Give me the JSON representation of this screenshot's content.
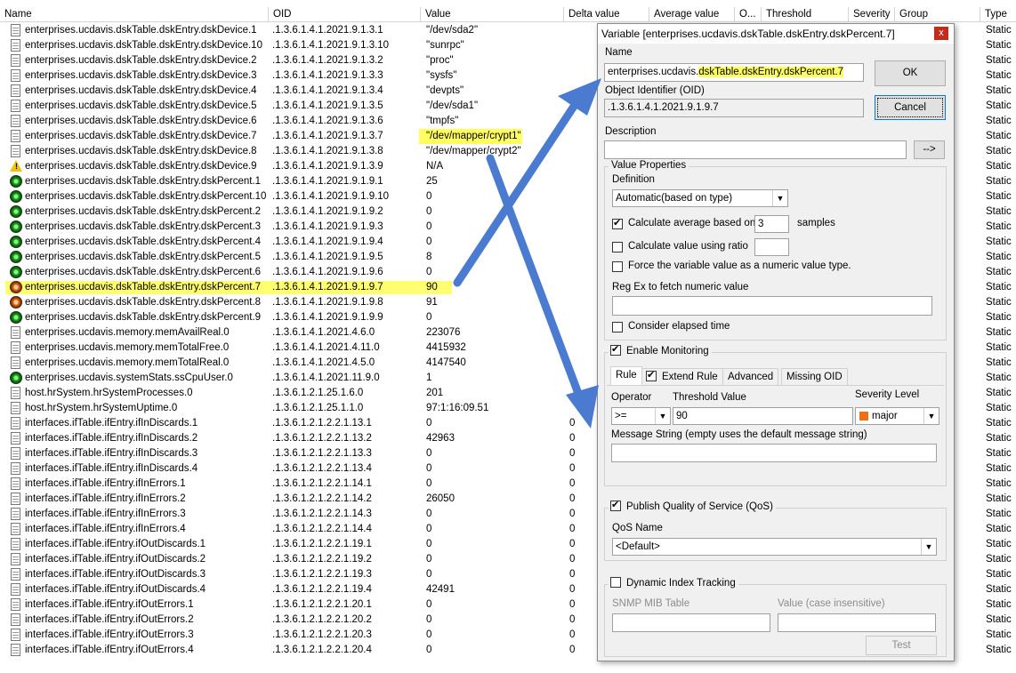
{
  "columns": {
    "name": "Name",
    "oid": "OID",
    "value": "Value",
    "delta": "Delta value",
    "average": "Average value",
    "o": "O...",
    "threshold": "Threshold",
    "severity": "Severity",
    "group": "Group",
    "type": "Type"
  },
  "rows": [
    {
      "icon": "doc",
      "name": "enterprises.ucdavis.dskTable.dskEntry.dskDevice.1",
      "oid": ".1.3.6.1.4.1.2021.9.1.3.1",
      "value": "\"/dev/sda2\"",
      "delta": "",
      "type": "Static"
    },
    {
      "icon": "doc",
      "name": "enterprises.ucdavis.dskTable.dskEntry.dskDevice.10",
      "oid": ".1.3.6.1.4.1.2021.9.1.3.10",
      "value": "\"sunrpc\"",
      "delta": "",
      "type": "Static"
    },
    {
      "icon": "doc",
      "name": "enterprises.ucdavis.dskTable.dskEntry.dskDevice.2",
      "oid": ".1.3.6.1.4.1.2021.9.1.3.2",
      "value": "\"proc\"",
      "delta": "",
      "type": "Static"
    },
    {
      "icon": "doc",
      "name": "enterprises.ucdavis.dskTable.dskEntry.dskDevice.3",
      "oid": ".1.3.6.1.4.1.2021.9.1.3.3",
      "value": "\"sysfs\"",
      "delta": "",
      "type": "Static"
    },
    {
      "icon": "doc",
      "name": "enterprises.ucdavis.dskTable.dskEntry.dskDevice.4",
      "oid": ".1.3.6.1.4.1.2021.9.1.3.4",
      "value": "\"devpts\"",
      "delta": "",
      "type": "Static"
    },
    {
      "icon": "doc",
      "name": "enterprises.ucdavis.dskTable.dskEntry.dskDevice.5",
      "oid": ".1.3.6.1.4.1.2021.9.1.3.5",
      "value": "\"/dev/sda1\"",
      "delta": "",
      "type": "Static"
    },
    {
      "icon": "doc",
      "name": "enterprises.ucdavis.dskTable.dskEntry.dskDevice.6",
      "oid": ".1.3.6.1.4.1.2021.9.1.3.6",
      "value": "\"tmpfs\"",
      "delta": "",
      "type": "Static"
    },
    {
      "icon": "doc",
      "name": "enterprises.ucdavis.dskTable.dskEntry.dskDevice.7",
      "oid": ".1.3.6.1.4.1.2021.9.1.3.7",
      "value": "\"/dev/mapper/crypt1\"",
      "delta": "",
      "type": "Static",
      "hl_value": true
    },
    {
      "icon": "doc",
      "name": "enterprises.ucdavis.dskTable.dskEntry.dskDevice.8",
      "oid": ".1.3.6.1.4.1.2021.9.1.3.8",
      "value": "\"/dev/mapper/crypt2\"",
      "delta": "",
      "type": "Static"
    },
    {
      "icon": "warn",
      "name": "enterprises.ucdavis.dskTable.dskEntry.dskDevice.9",
      "oid": ".1.3.6.1.4.1.2021.9.1.3.9",
      "value": "N/A",
      "delta": "",
      "type": "Static"
    },
    {
      "icon": "ok",
      "name": "enterprises.ucdavis.dskTable.dskEntry.dskPercent.1",
      "oid": ".1.3.6.1.4.1.2021.9.1.9.1",
      "value": "25",
      "delta": "",
      "type": "Static"
    },
    {
      "icon": "ok",
      "name": "enterprises.ucdavis.dskTable.dskEntry.dskPercent.10",
      "oid": ".1.3.6.1.4.1.2021.9.1.9.10",
      "value": "0",
      "delta": "",
      "type": "Static"
    },
    {
      "icon": "ok",
      "name": "enterprises.ucdavis.dskTable.dskEntry.dskPercent.2",
      "oid": ".1.3.6.1.4.1.2021.9.1.9.2",
      "value": "0",
      "delta": "",
      "type": "Static"
    },
    {
      "icon": "ok",
      "name": "enterprises.ucdavis.dskTable.dskEntry.dskPercent.3",
      "oid": ".1.3.6.1.4.1.2021.9.1.9.3",
      "value": "0",
      "delta": "",
      "type": "Static"
    },
    {
      "icon": "ok",
      "name": "enterprises.ucdavis.dskTable.dskEntry.dskPercent.4",
      "oid": ".1.3.6.1.4.1.2021.9.1.9.4",
      "value": "0",
      "delta": "",
      "type": "Static"
    },
    {
      "icon": "ok",
      "name": "enterprises.ucdavis.dskTable.dskEntry.dskPercent.5",
      "oid": ".1.3.6.1.4.1.2021.9.1.9.5",
      "value": "8",
      "delta": "",
      "type": "Static"
    },
    {
      "icon": "ok",
      "name": "enterprises.ucdavis.dskTable.dskEntry.dskPercent.6",
      "oid": ".1.3.6.1.4.1.2021.9.1.9.6",
      "value": "0",
      "delta": "",
      "type": "Static"
    },
    {
      "icon": "major",
      "name": "enterprises.ucdavis.dskTable.dskEntry.dskPercent.7",
      "oid": ".1.3.6.1.4.1.2021.9.1.9.7",
      "value": "90",
      "delta": "",
      "type": "Static",
      "hl_row": true
    },
    {
      "icon": "major",
      "name": "enterprises.ucdavis.dskTable.dskEntry.dskPercent.8",
      "oid": ".1.3.6.1.4.1.2021.9.1.9.8",
      "value": "91",
      "delta": "",
      "type": "Static"
    },
    {
      "icon": "ok",
      "name": "enterprises.ucdavis.dskTable.dskEntry.dskPercent.9",
      "oid": ".1.3.6.1.4.1.2021.9.1.9.9",
      "value": "0",
      "delta": "",
      "type": "Static"
    },
    {
      "icon": "doc",
      "name": "enterprises.ucdavis.memory.memAvailReal.0",
      "oid": ".1.3.6.1.4.1.2021.4.6.0",
      "value": "223076",
      "delta": "",
      "type": "Static"
    },
    {
      "icon": "doc",
      "name": "enterprises.ucdavis.memory.memTotalFree.0",
      "oid": ".1.3.6.1.4.1.2021.4.11.0",
      "value": "4415932",
      "delta": "",
      "type": "Static"
    },
    {
      "icon": "doc",
      "name": "enterprises.ucdavis.memory.memTotalReal.0",
      "oid": ".1.3.6.1.4.1.2021.4.5.0",
      "value": "4147540",
      "delta": "",
      "type": "Static"
    },
    {
      "icon": "ok",
      "name": "enterprises.ucdavis.systemStats.ssCpuUser.0",
      "oid": ".1.3.6.1.4.1.2021.11.9.0",
      "value": "1",
      "delta": "",
      "type": "Static"
    },
    {
      "icon": "doc",
      "name": "host.hrSystem.hrSystemProcesses.0",
      "oid": ".1.3.6.1.2.1.25.1.6.0",
      "value": "201",
      "delta": "",
      "type": "Static"
    },
    {
      "icon": "doc",
      "name": "host.hrSystem.hrSystemUptime.0",
      "oid": ".1.3.6.1.2.1.25.1.1.0",
      "value": "97:1:16:09.51",
      "delta": "",
      "type": "Static"
    },
    {
      "icon": "doc",
      "name": "interfaces.ifTable.ifEntry.ifInDiscards.1",
      "oid": ".1.3.6.1.2.1.2.2.1.13.1",
      "value": "0",
      "delta": "0",
      "type": "Static"
    },
    {
      "icon": "doc",
      "name": "interfaces.ifTable.ifEntry.ifInDiscards.2",
      "oid": ".1.3.6.1.2.1.2.2.1.13.2",
      "value": "42963",
      "delta": "0",
      "type": "Static"
    },
    {
      "icon": "doc",
      "name": "interfaces.ifTable.ifEntry.ifInDiscards.3",
      "oid": ".1.3.6.1.2.1.2.2.1.13.3",
      "value": "0",
      "delta": "0",
      "type": "Static"
    },
    {
      "icon": "doc",
      "name": "interfaces.ifTable.ifEntry.ifInDiscards.4",
      "oid": ".1.3.6.1.2.1.2.2.1.13.4",
      "value": "0",
      "delta": "0",
      "type": "Static"
    },
    {
      "icon": "doc",
      "name": "interfaces.ifTable.ifEntry.ifInErrors.1",
      "oid": ".1.3.6.1.2.1.2.2.1.14.1",
      "value": "0",
      "delta": "0",
      "type": "Static"
    },
    {
      "icon": "doc",
      "name": "interfaces.ifTable.ifEntry.ifInErrors.2",
      "oid": ".1.3.6.1.2.1.2.2.1.14.2",
      "value": "26050",
      "delta": "0",
      "type": "Static"
    },
    {
      "icon": "doc",
      "name": "interfaces.ifTable.ifEntry.ifInErrors.3",
      "oid": ".1.3.6.1.2.1.2.2.1.14.3",
      "value": "0",
      "delta": "0",
      "type": "Static"
    },
    {
      "icon": "doc",
      "name": "interfaces.ifTable.ifEntry.ifInErrors.4",
      "oid": ".1.3.6.1.2.1.2.2.1.14.4",
      "value": "0",
      "delta": "0",
      "type": "Static"
    },
    {
      "icon": "doc",
      "name": "interfaces.ifTable.ifEntry.ifOutDiscards.1",
      "oid": ".1.3.6.1.2.1.2.2.1.19.1",
      "value": "0",
      "delta": "0",
      "type": "Static"
    },
    {
      "icon": "doc",
      "name": "interfaces.ifTable.ifEntry.ifOutDiscards.2",
      "oid": ".1.3.6.1.2.1.2.2.1.19.2",
      "value": "0",
      "delta": "0",
      "type": "Static"
    },
    {
      "icon": "doc",
      "name": "interfaces.ifTable.ifEntry.ifOutDiscards.3",
      "oid": ".1.3.6.1.2.1.2.2.1.19.3",
      "value": "0",
      "delta": "0",
      "type": "Static"
    },
    {
      "icon": "doc",
      "name": "interfaces.ifTable.ifEntry.ifOutDiscards.4",
      "oid": ".1.3.6.1.2.1.2.2.1.19.4",
      "value": "42491",
      "delta": "0",
      "type": "Static"
    },
    {
      "icon": "doc",
      "name": "interfaces.ifTable.ifEntry.ifOutErrors.1",
      "oid": ".1.3.6.1.2.1.2.2.1.20.1",
      "value": "0",
      "delta": "0",
      "type": "Static"
    },
    {
      "icon": "doc",
      "name": "interfaces.ifTable.ifEntry.ifOutErrors.2",
      "oid": ".1.3.6.1.2.1.2.2.1.20.2",
      "value": "0",
      "delta": "0",
      "type": "Static"
    },
    {
      "icon": "doc",
      "name": "interfaces.ifTable.ifEntry.ifOutErrors.3",
      "oid": ".1.3.6.1.2.1.2.2.1.20.3",
      "value": "0",
      "delta": "0",
      "type": "Static"
    },
    {
      "icon": "doc",
      "name": "interfaces.ifTable.ifEntry.ifOutErrors.4",
      "oid": ".1.3.6.1.2.1.2.2.1.20.4",
      "value": "0",
      "delta": "0",
      "type": "Static"
    }
  ],
  "dialog": {
    "title": "Variable [enterprises.ucdavis.dskTable.dskEntry.dskPercent.7]",
    "close_glyph": "x",
    "name_label": "Name",
    "name_value_plain": "enterprises.ucdavis.",
    "name_value_highlight": "dskTable.dskEntry.dskPercent.7",
    "ok_label": "OK",
    "cancel_label": "Cancel",
    "oid_label": "Object Identifier (OID)",
    "oid_value": ".1.3.6.1.4.1.2021.9.1.9.7",
    "description_label": "Description",
    "description_value": "",
    "desc_button": "-->",
    "value_props": {
      "group_label": "Value Properties",
      "definition_label": "Definition",
      "definition_value": "Automatic(based on type)",
      "calc_avg_label": "Calculate average based on",
      "calc_avg_checked": true,
      "samples_value": "3",
      "samples_label": "samples",
      "ratio_label": "Calculate value using ratio",
      "ratio_checked": false,
      "ratio_value": "",
      "force_numeric_label": "Force the variable value as a numeric value type.",
      "force_numeric_checked": false,
      "regex_label": "Reg Ex to fetch numeric value",
      "regex_value": "",
      "elapsed_label": "Consider elapsed time",
      "elapsed_checked": false
    },
    "monitoring": {
      "enable_label": "Enable Monitoring",
      "enable_checked": true,
      "tabs": [
        "Rule",
        "Extend Rule",
        "Advanced",
        "Missing OID"
      ],
      "extend_checked": true,
      "operator_label": "Operator",
      "operator_value": ">=",
      "threshold_label": "Threshold Value",
      "threshold_value": "90",
      "severity_label": "Severity Level",
      "severity_value": "major",
      "severity_color": "#f07010",
      "message_label": "Message String (empty uses the default message string)",
      "message_value": ""
    },
    "qos": {
      "label": "Publish Quality of Service (QoS)",
      "checked": true,
      "name_label": "QoS Name",
      "name_value": "<Default>"
    },
    "dynamic": {
      "label": "Dynamic Index Tracking",
      "checked": false,
      "mib_label": "SNMP MIB Table",
      "value_label": "Value (case insensitive)",
      "test_label": "Test"
    }
  },
  "colors": {
    "highlight": "#ffff60",
    "arrow": "#4a7bd0"
  }
}
